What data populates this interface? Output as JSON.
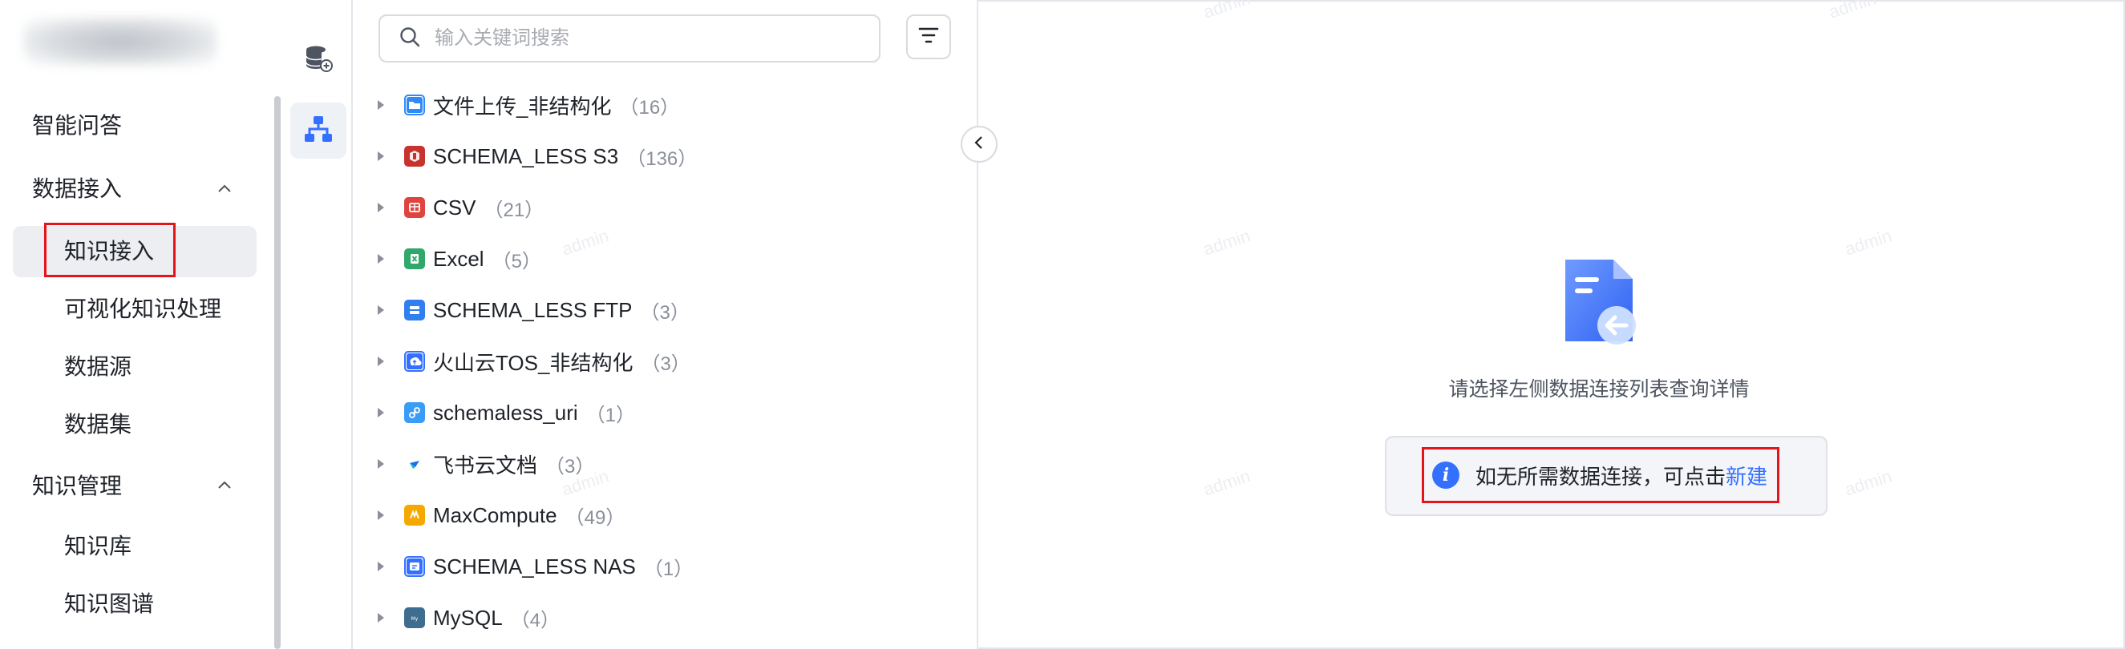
{
  "sidebar": {
    "items": [
      {
        "label": "智能问答"
      },
      {
        "label": "数据接入"
      },
      {
        "label": "知识接入"
      },
      {
        "label": "可视化知识处理"
      },
      {
        "label": "数据源"
      },
      {
        "label": "数据集"
      },
      {
        "label": "知识管理"
      },
      {
        "label": "知识库"
      },
      {
        "label": "知识图谱"
      }
    ]
  },
  "rail": {
    "icons": [
      "database-add-icon",
      "tree-structure-icon"
    ]
  },
  "search": {
    "placeholder": "输入关键词搜索",
    "value": ""
  },
  "tree": {
    "items": [
      {
        "label": "文件上传_非结构化",
        "count": "（16）",
        "icon": "folder-icon",
        "color": "#2f8af5"
      },
      {
        "label": "SCHEMA_LESS S3",
        "count": "（136）",
        "icon": "s3-icon",
        "color": "#c7332f"
      },
      {
        "label": "CSV",
        "count": "（21）",
        "icon": "csv-icon",
        "color": "#e0443e"
      },
      {
        "label": "Excel",
        "count": "（5）",
        "icon": "excel-icon",
        "color": "#2fa86a"
      },
      {
        "label": "SCHEMA_LESS FTP",
        "count": "（3）",
        "icon": "ftp-icon",
        "color": "#2f7ff0"
      },
      {
        "label": "火山云TOS_非结构化",
        "count": "（3）",
        "icon": "tos-icon",
        "color": "#3470ff"
      },
      {
        "label": "schemaless_uri",
        "count": "（1）",
        "icon": "link-icon",
        "color": "#3b9cf5"
      },
      {
        "label": "飞书云文档",
        "count": "（3）",
        "icon": "feishu-icon",
        "color": "#1f6df0"
      },
      {
        "label": "MaxCompute",
        "count": "（49）",
        "icon": "maxcompute-icon",
        "color": "#f5a800"
      },
      {
        "label": "SCHEMA_LESS NAS",
        "count": "（1）",
        "icon": "nas-icon",
        "color": "#3470ff"
      },
      {
        "label": "MySQL",
        "count": "（4）",
        "icon": "mysql-icon",
        "color": "#3f6d8f"
      }
    ]
  },
  "detail": {
    "empty_text": "请选择左侧数据连接列表查询详情",
    "notice_text": "如无所需数据连接，可点击",
    "notice_link": "新建"
  },
  "watermark": "admin",
  "colors": {
    "accent": "#3470ff",
    "highlight_border": "#e6131a",
    "active_bg": "#eceef2"
  }
}
